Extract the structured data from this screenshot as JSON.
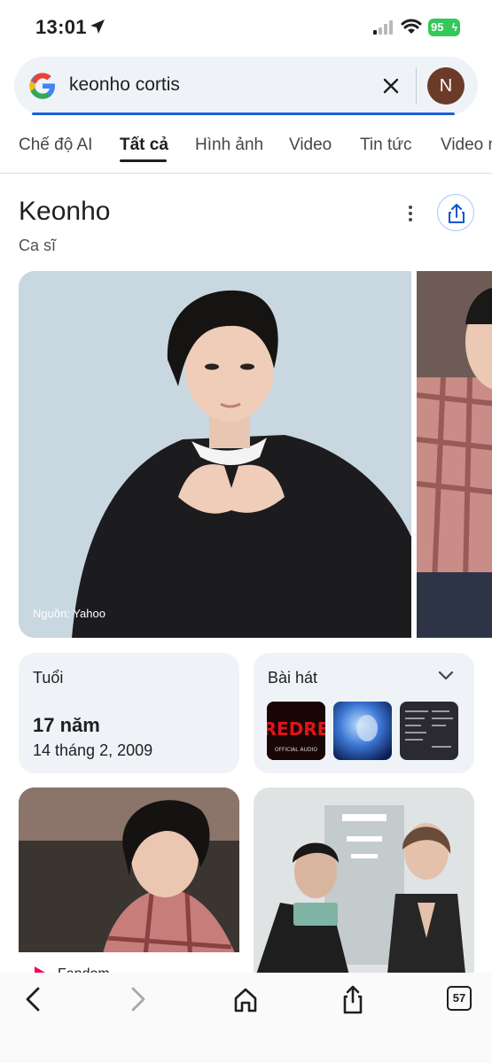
{
  "status_bar": {
    "time": "13:01",
    "battery": "95"
  },
  "search": {
    "query": "keonho cortis",
    "avatar_initial": "N"
  },
  "tabs": [
    {
      "label": "Chế độ AI"
    },
    {
      "label": "Tất cả",
      "active": true
    },
    {
      "label": "Hình ảnh"
    },
    {
      "label": "Video"
    },
    {
      "label": "Tin tức"
    },
    {
      "label": "Video n"
    }
  ],
  "knowledge_panel": {
    "title": "Keonho",
    "subtitle": "Ca sĩ",
    "image_source": "Nguồn: Yahoo",
    "age_card": {
      "label": "Tuổi",
      "value": "17 năm",
      "date": "14 tháng 2, 2009"
    },
    "songs_card": {
      "label": "Bài hát",
      "thumb1_text": "REDRE",
      "thumb1_sub": "OFFICIAL AUDIO"
    },
    "fandom_label": "Fandom"
  },
  "toolbar": {
    "tabs_count": "57"
  },
  "colors": {
    "accent": "#1a5fd6",
    "card_bg": "#eff3f8",
    "battery": "#34c759",
    "avatar": "#6b3b2a"
  }
}
